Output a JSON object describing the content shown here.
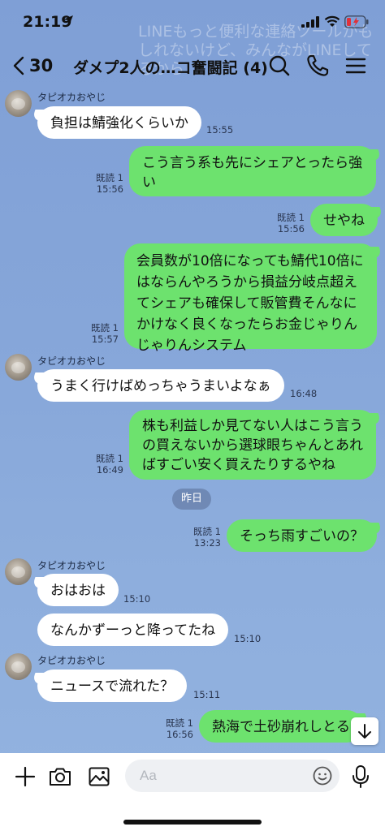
{
  "background": {
    "watermark": "LINEもっと便利な連絡ツールかもしれないけど、みんながLINEしてるから"
  },
  "status": {
    "time": "21:19"
  },
  "header": {
    "back_count": "30",
    "title": "ダメプ2人の…コ奮闘記 (4)"
  },
  "messages": [
    {
      "dir": "in",
      "sender": "タピオカおやじ",
      "text": "負担は鯖強化くらいか",
      "time": "15:55"
    },
    {
      "dir": "out",
      "read": "既読 1",
      "time": "15:56",
      "text": "こう言う系も先にシェアとったら強い"
    },
    {
      "dir": "out",
      "read": "既読 1",
      "time": "15:56",
      "text": "せやね"
    },
    {
      "dir": "out",
      "read": "既読 1",
      "time": "15:57",
      "text": "会員数が10倍になっても鯖代10倍にはならんやろうから損益分岐点超えてシェアも確保して販管費そんなにかけなく良くなったらお金じゃりんじゃりんシステム"
    },
    {
      "dir": "in",
      "sender": "タピオカおやじ",
      "text": "うまく行けばめっちゃうまいよなぁ",
      "time": "16:48"
    },
    {
      "dir": "out",
      "read": "既読 1",
      "time": "16:49",
      "text": "株も利益しか見てない人はこう言うの買えないから選球眼ちゃんとあればすごい安く買えたりするやね"
    },
    {
      "dir": "out",
      "read": "既読 1",
      "time": "13:23",
      "text": "そっち雨すごいの？"
    },
    {
      "dir": "in",
      "sender": "タピオカおやじ",
      "text": "おはおは",
      "time": "15:10"
    },
    {
      "dir": "in",
      "text": "なんかずーっと降ってたね",
      "time": "15:10"
    },
    {
      "dir": "in",
      "sender": "タピオカおやじ",
      "text": "ニュースで流れた？",
      "time": "15:11"
    },
    {
      "dir": "out",
      "read": "既読 1",
      "time": "16:56",
      "text": "熱海で土砂崩れしとる"
    }
  ],
  "date_separator": "昨日",
  "input": {
    "placeholder": "Aa"
  },
  "icons": {
    "header": [
      "chevron-left-icon",
      "search-icon",
      "phone-icon",
      "menu-icon"
    ],
    "input_bar": [
      "plus-icon",
      "camera-icon",
      "image-icon",
      "emoji-icon",
      "mic-icon"
    ],
    "scroll": "arrow-down-icon"
  },
  "colors": {
    "outgoing_bubble": "#6de26e",
    "incoming_bubble": "#ffffff",
    "chat_background": "#86a6d9"
  }
}
